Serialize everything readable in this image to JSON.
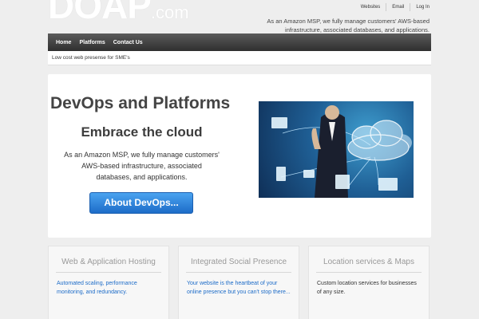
{
  "brand": {
    "name": "DOAP",
    "suffix": ".com"
  },
  "top_links": [
    "Websites",
    "Email",
    "Log In"
  ],
  "tagline": "As an Amazon MSP, we fully manage customers' AWS-based infrastructure, associated databases, and applications.",
  "nav": {
    "items": [
      "Home",
      "Platforms",
      "Contact Us"
    ]
  },
  "subbar": {
    "text": "Low cost web presense for SME's"
  },
  "hero": {
    "title": "DevOps and Platforms",
    "subtitle": "Embrace the cloud",
    "text": "As an Amazon MSP, we fully manage customers' AWS-based infrastructure, associated databases, and applications.",
    "button_label": "About DevOps..."
  },
  "features": [
    {
      "title": "Web & Application Hosting",
      "body": "Automated scaling, performance monitoring, and redundancy."
    },
    {
      "title": "Integrated Social Presence",
      "body": "Your website is the heartbeat of your online presence but you can't stop there..."
    },
    {
      "title": "Location services & Maps",
      "body": "Custom location services for businesses of any size."
    }
  ],
  "colors": {
    "accent": "#1d6cc8",
    "nav_bg": "#3a3a3a",
    "page_bg": "#eeeeee"
  }
}
